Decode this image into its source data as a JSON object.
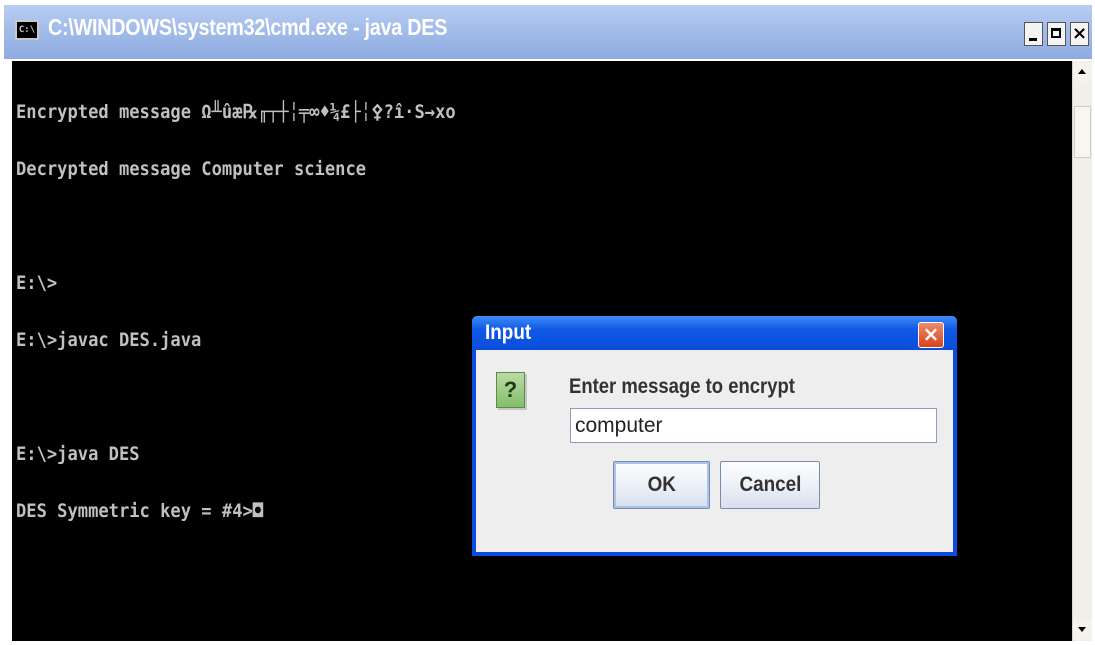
{
  "window": {
    "title": "C:\\WINDOWS\\system32\\cmd.exe - java DES",
    "icon_text": "C:\\",
    "controls": {
      "minimize": "minimize-icon",
      "maximize": "maximize-icon",
      "close_label": "×"
    }
  },
  "console": {
    "lines": [
      "Encrypted message Ω╨ûæ℞╓┬┼╎╤∞♦¼£├╎⚴?î·S→xo",
      "Decrypted message Computer science",
      "",
      "E:\\>",
      "E:\\>javac DES.java",
      "",
      "E:\\>java DES",
      "DES Symmetric key = #4>◘"
    ]
  },
  "dialog": {
    "title": "Input",
    "close_label": "×",
    "icon_label": "?",
    "prompt": "Enter message to encrypt",
    "input_value": "computer",
    "ok_label": "OK",
    "cancel_label": "Cancel"
  },
  "colors": {
    "console_bg": "#000000",
    "console_text": "#c0c0c0",
    "dialog_title_blue": "#0a4be0",
    "dialog_close_red": "#d9421c",
    "question_icon_green": "#84be68"
  }
}
